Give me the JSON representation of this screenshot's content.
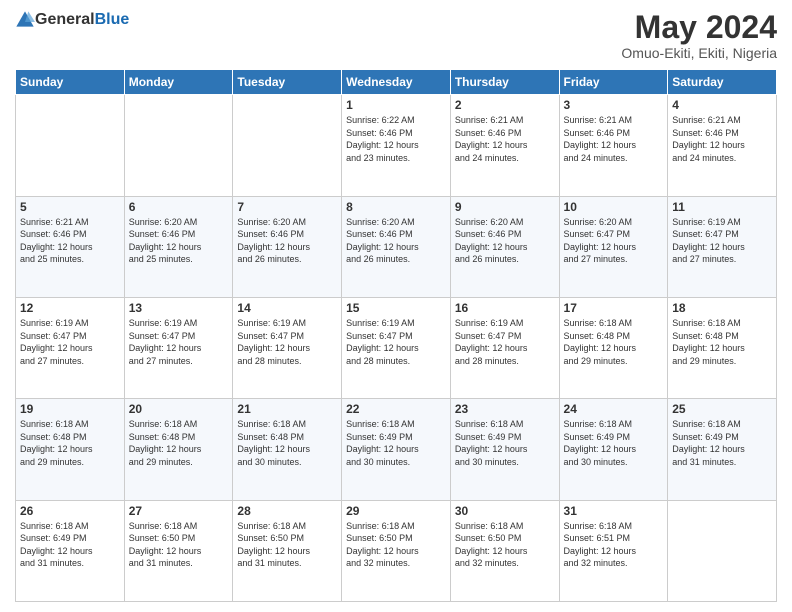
{
  "header": {
    "logo_general": "General",
    "logo_blue": "Blue",
    "month_year": "May 2024",
    "location": "Omuo-Ekiti, Ekiti, Nigeria"
  },
  "weekdays": [
    "Sunday",
    "Monday",
    "Tuesday",
    "Wednesday",
    "Thursday",
    "Friday",
    "Saturday"
  ],
  "weeks": [
    [
      {
        "day": "",
        "info": ""
      },
      {
        "day": "",
        "info": ""
      },
      {
        "day": "",
        "info": ""
      },
      {
        "day": "1",
        "info": "Sunrise: 6:22 AM\nSunset: 6:46 PM\nDaylight: 12 hours\nand 23 minutes."
      },
      {
        "day": "2",
        "info": "Sunrise: 6:21 AM\nSunset: 6:46 PM\nDaylight: 12 hours\nand 24 minutes."
      },
      {
        "day": "3",
        "info": "Sunrise: 6:21 AM\nSunset: 6:46 PM\nDaylight: 12 hours\nand 24 minutes."
      },
      {
        "day": "4",
        "info": "Sunrise: 6:21 AM\nSunset: 6:46 PM\nDaylight: 12 hours\nand 24 minutes."
      }
    ],
    [
      {
        "day": "5",
        "info": "Sunrise: 6:21 AM\nSunset: 6:46 PM\nDaylight: 12 hours\nand 25 minutes."
      },
      {
        "day": "6",
        "info": "Sunrise: 6:20 AM\nSunset: 6:46 PM\nDaylight: 12 hours\nand 25 minutes."
      },
      {
        "day": "7",
        "info": "Sunrise: 6:20 AM\nSunset: 6:46 PM\nDaylight: 12 hours\nand 26 minutes."
      },
      {
        "day": "8",
        "info": "Sunrise: 6:20 AM\nSunset: 6:46 PM\nDaylight: 12 hours\nand 26 minutes."
      },
      {
        "day": "9",
        "info": "Sunrise: 6:20 AM\nSunset: 6:46 PM\nDaylight: 12 hours\nand 26 minutes."
      },
      {
        "day": "10",
        "info": "Sunrise: 6:20 AM\nSunset: 6:47 PM\nDaylight: 12 hours\nand 27 minutes."
      },
      {
        "day": "11",
        "info": "Sunrise: 6:19 AM\nSunset: 6:47 PM\nDaylight: 12 hours\nand 27 minutes."
      }
    ],
    [
      {
        "day": "12",
        "info": "Sunrise: 6:19 AM\nSunset: 6:47 PM\nDaylight: 12 hours\nand 27 minutes."
      },
      {
        "day": "13",
        "info": "Sunrise: 6:19 AM\nSunset: 6:47 PM\nDaylight: 12 hours\nand 27 minutes."
      },
      {
        "day": "14",
        "info": "Sunrise: 6:19 AM\nSunset: 6:47 PM\nDaylight: 12 hours\nand 28 minutes."
      },
      {
        "day": "15",
        "info": "Sunrise: 6:19 AM\nSunset: 6:47 PM\nDaylight: 12 hours\nand 28 minutes."
      },
      {
        "day": "16",
        "info": "Sunrise: 6:19 AM\nSunset: 6:47 PM\nDaylight: 12 hours\nand 28 minutes."
      },
      {
        "day": "17",
        "info": "Sunrise: 6:18 AM\nSunset: 6:48 PM\nDaylight: 12 hours\nand 29 minutes."
      },
      {
        "day": "18",
        "info": "Sunrise: 6:18 AM\nSunset: 6:48 PM\nDaylight: 12 hours\nand 29 minutes."
      }
    ],
    [
      {
        "day": "19",
        "info": "Sunrise: 6:18 AM\nSunset: 6:48 PM\nDaylight: 12 hours\nand 29 minutes."
      },
      {
        "day": "20",
        "info": "Sunrise: 6:18 AM\nSunset: 6:48 PM\nDaylight: 12 hours\nand 29 minutes."
      },
      {
        "day": "21",
        "info": "Sunrise: 6:18 AM\nSunset: 6:48 PM\nDaylight: 12 hours\nand 30 minutes."
      },
      {
        "day": "22",
        "info": "Sunrise: 6:18 AM\nSunset: 6:49 PM\nDaylight: 12 hours\nand 30 minutes."
      },
      {
        "day": "23",
        "info": "Sunrise: 6:18 AM\nSunset: 6:49 PM\nDaylight: 12 hours\nand 30 minutes."
      },
      {
        "day": "24",
        "info": "Sunrise: 6:18 AM\nSunset: 6:49 PM\nDaylight: 12 hours\nand 30 minutes."
      },
      {
        "day": "25",
        "info": "Sunrise: 6:18 AM\nSunset: 6:49 PM\nDaylight: 12 hours\nand 31 minutes."
      }
    ],
    [
      {
        "day": "26",
        "info": "Sunrise: 6:18 AM\nSunset: 6:49 PM\nDaylight: 12 hours\nand 31 minutes."
      },
      {
        "day": "27",
        "info": "Sunrise: 6:18 AM\nSunset: 6:50 PM\nDaylight: 12 hours\nand 31 minutes."
      },
      {
        "day": "28",
        "info": "Sunrise: 6:18 AM\nSunset: 6:50 PM\nDaylight: 12 hours\nand 31 minutes."
      },
      {
        "day": "29",
        "info": "Sunrise: 6:18 AM\nSunset: 6:50 PM\nDaylight: 12 hours\nand 32 minutes."
      },
      {
        "day": "30",
        "info": "Sunrise: 6:18 AM\nSunset: 6:50 PM\nDaylight: 12 hours\nand 32 minutes."
      },
      {
        "day": "31",
        "info": "Sunrise: 6:18 AM\nSunset: 6:51 PM\nDaylight: 12 hours\nand 32 minutes."
      },
      {
        "day": "",
        "info": ""
      }
    ]
  ]
}
